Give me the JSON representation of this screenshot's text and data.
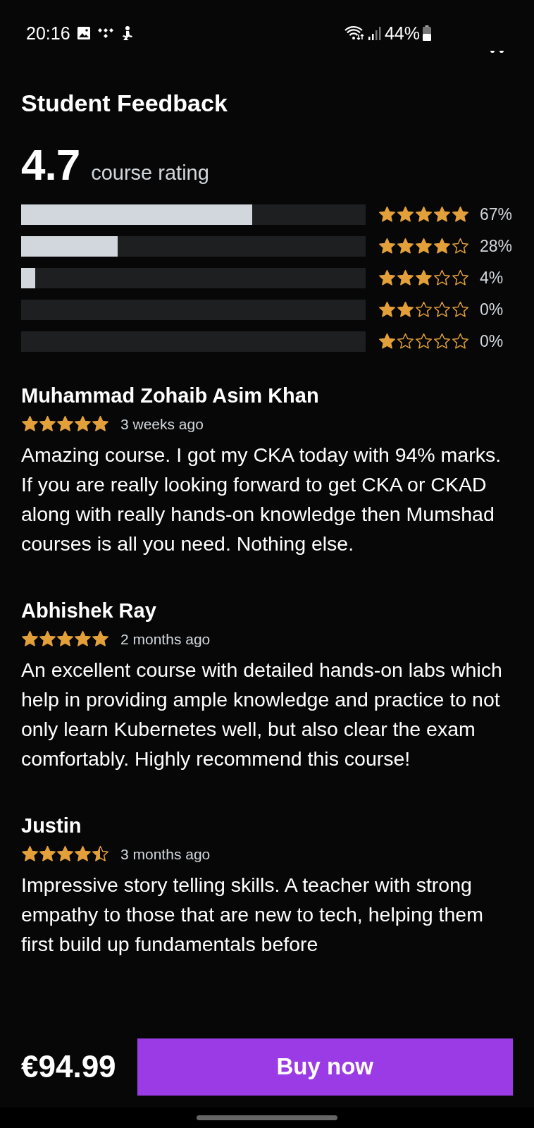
{
  "status_bar": {
    "time": "20:16",
    "battery": "44%"
  },
  "title": "Student Feedback",
  "rating": {
    "value": "4.7",
    "label": "course rating"
  },
  "distribution": [
    {
      "level": 0.67,
      "stars": 5,
      "percent": "67%"
    },
    {
      "level": 0.28,
      "stars": 4,
      "percent": "28%"
    },
    {
      "level": 0.04,
      "stars": 3,
      "percent": "4%"
    },
    {
      "level": 0.0,
      "stars": 2,
      "percent": "0%"
    },
    {
      "level": 0.0,
      "stars": 1,
      "percent": "0%"
    }
  ],
  "reviews": [
    {
      "name": "Muhammad Zohaib Asim Khan",
      "stars": 5,
      "time": "3 weeks ago",
      "text": "Amazing course. I got my CKA today with 94% marks. If you are really looking forward to get CKA or CKAD along with really hands-on knowledge then Mumshad courses is all you need. Nothing else."
    },
    {
      "name": "Abhishek Ray",
      "stars": 5,
      "time": "2 months ago",
      "text": "An excellent course with detailed hands-on labs which help in providing ample knowledge and practice to not only learn Kubernetes well, but also clear the exam comfortably. Highly recommend this course!"
    },
    {
      "name": "Justin",
      "stars": 4.5,
      "time": "3 months ago",
      "text": "Impressive story telling skills. A teacher with strong empathy to those that are new to tech, helping them first build up fundamentals before"
    }
  ],
  "footer": {
    "price": "€94.99",
    "button": "Buy now"
  }
}
